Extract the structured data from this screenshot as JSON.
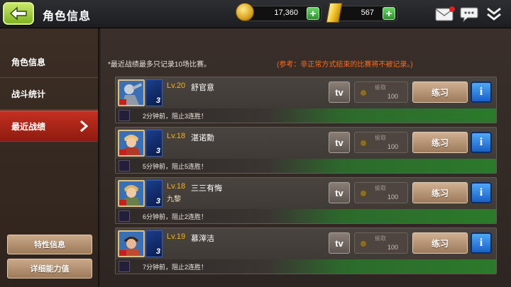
{
  "header": {
    "title": "角色信息",
    "coins": "17,360",
    "gold": "567"
  },
  "sidebar": {
    "items": [
      {
        "label": "角色信息",
        "active": false
      },
      {
        "label": "战斗统计",
        "active": false
      },
      {
        "label": "最近战绩",
        "active": true
      }
    ],
    "buttons": [
      {
        "label": "特性信息"
      },
      {
        "label": "详细能力值"
      }
    ]
  },
  "main": {
    "note": "*最近战绩最多只记录10场比赛。",
    "note_warning": "(参考：非正常方式结束的比赛将不被记录。)",
    "tv_label": "tv",
    "steal_label": "偷取",
    "practice_label": "练习",
    "info_label": "i",
    "records": [
      {
        "level": "Lv.20",
        "name": "舒官意",
        "guild": "",
        "rank": "3",
        "steal_value": "100",
        "message": "2分钟前，阻止3连胜！"
      },
      {
        "level": "Lv.18",
        "name": "湛诺勳",
        "guild": "",
        "rank": "3",
        "steal_value": "100",
        "message": "5分钟前，阻止5连胜！"
      },
      {
        "level": "Lv.18",
        "name": "三三有悔",
        "guild": "九黎",
        "rank": "3",
        "steal_value": "100",
        "message": "6分钟前，阻止2连胜！"
      },
      {
        "level": "Lv.19",
        "name": "慕滓洁",
        "guild": "",
        "rank": "3",
        "steal_value": "100",
        "message": "7分钟前，阻止2连胜！"
      }
    ]
  },
  "colors": {
    "accent_red": "#c4301f",
    "level_orange": "#f5b21a",
    "warning_orange": "#ff6a1a",
    "back_green": "#7fb321"
  }
}
